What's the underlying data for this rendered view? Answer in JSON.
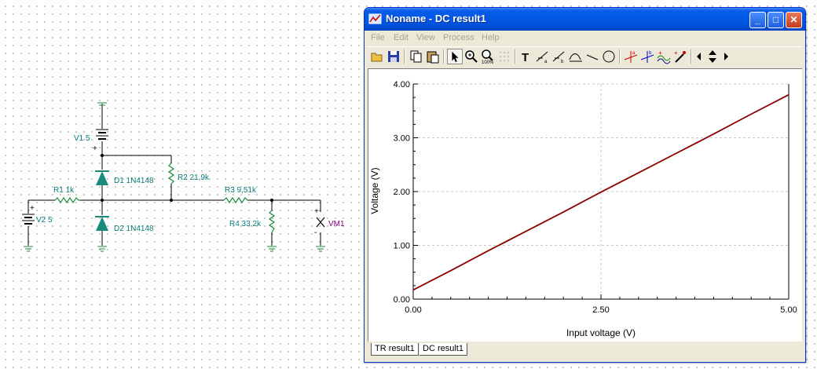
{
  "schematic": {
    "labels": {
      "v1": "V1 5",
      "d1": "D1 1N4148",
      "r2": "R2 21,9k",
      "r1": "R1 1k",
      "r3": "R3 9,51k",
      "v2": "V2 5",
      "d2": "D2 1N4148",
      "r4": "R4 33,2k",
      "vm1": "VM1",
      "v1_plus": "+",
      "v2_plus": "+",
      "vm1_plus": "+",
      "vm1_minus": "-"
    },
    "wire_color": "#000000",
    "label_color": "#0a7a7a",
    "component_color": "#1a8a3a",
    "diode_fill": "#1a8a7a",
    "meter_color": "#800080"
  },
  "window": {
    "title": "Noname - DC result1",
    "buttons": {
      "minimize": "_",
      "maximize": "□",
      "close": "✕"
    },
    "menu": [
      "File",
      "Edit",
      "View",
      "Process",
      "Help"
    ],
    "toolbar_icons": [
      "open-icon",
      "save-icon",
      "copy-icon",
      "paste-icon",
      "pointer-icon",
      "zoom-in-icon",
      "zoom-100-icon",
      "grid-icon",
      "text-icon",
      "cursor-a-icon",
      "cursor-b-icon",
      "cursor-ab-icon",
      "line-icon",
      "circle-icon",
      "marker-a-icon",
      "marker-b-icon",
      "curve-add-icon",
      "probe-icon",
      "scroll-left-icon",
      "scroll-up-down-icon",
      "scroll-right-icon"
    ],
    "tabs": [
      "TR result1",
      "DC result1"
    ],
    "active_tab": "DC result1"
  },
  "chart_data": {
    "type": "line",
    "xlabel": "Input voltage (V)",
    "ylabel": "Voltage (V)",
    "xlim": [
      0,
      5
    ],
    "ylim": [
      0,
      4
    ],
    "x_ticks": [
      "0.00",
      "2.50",
      "5.00"
    ],
    "y_ticks": [
      "0.00",
      "1.00",
      "2.00",
      "3.00",
      "4.00"
    ],
    "grid": "dashed at 2.50 V (x) and each 1.00 V (y)",
    "series": [
      {
        "color": "#8b0000",
        "x": [
          0,
          0.5,
          1,
          1.5,
          2,
          2.5,
          3,
          3.5,
          4,
          4.5,
          5
        ],
        "y": [
          0.17,
          0.53,
          0.9,
          1.26,
          1.62,
          1.99,
          2.35,
          2.71,
          3.07,
          3.44,
          3.8
        ]
      }
    ]
  }
}
